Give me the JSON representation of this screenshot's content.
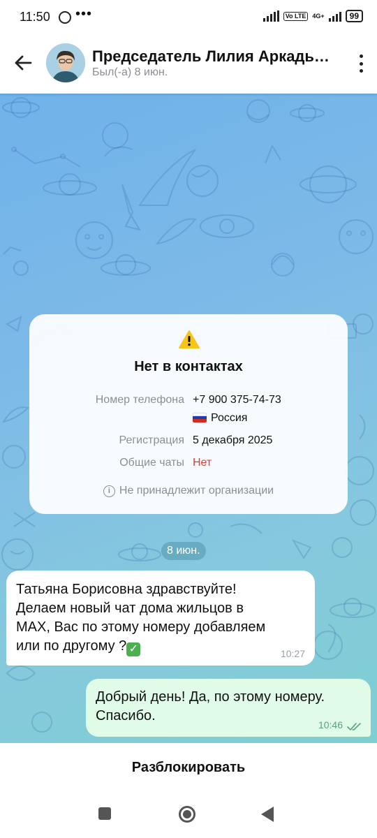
{
  "status_bar": {
    "time": "11:50",
    "dots": "•••",
    "volte": "Vo LTE",
    "network": "4G+",
    "battery": "99"
  },
  "header": {
    "title": "Председатель Лилия Аркадь…",
    "subtitle": "Был(-а) 8 июн."
  },
  "info_card": {
    "title": "Нет в контактах",
    "phone_label": "Номер телефона",
    "phone_value": "+7 900 375-74-73",
    "country": "Россия",
    "registration_label": "Регистрация",
    "registration_value": "5 декабря 2025",
    "common_chats_label": "Общие чаты",
    "common_chats_value": "Нет",
    "org_note": "Не принадлежит организации"
  },
  "date_separator": "8 июн.",
  "messages": [
    {
      "direction": "incoming",
      "lines": [
        "Татьяна Борисовна здравствуйте!",
        "Делаем новый чат дома жильцов в",
        "MAX,  Вас по этому номеру добавляем",
        "или по другому ?"
      ],
      "time": "10:27"
    },
    {
      "direction": "outgoing",
      "lines": [
        "Добрый день! Да, по этому номеру.",
        "Спасибо."
      ],
      "time": "10:46"
    }
  ],
  "unblock_label": "Разблокировать",
  "colors": {
    "chat_bg_top": "#6fb3ea",
    "chat_bg_bottom": "#7fcfd2",
    "outgoing_bubble": "#e1fbe9",
    "warning": "#f5c518",
    "danger": "#e53935"
  },
  "icons": [
    "back-arrow-icon",
    "more-vert-icon",
    "warning-icon",
    "info-icon",
    "checkmark-icon",
    "double-check-icon",
    "russia-flag-icon"
  ]
}
